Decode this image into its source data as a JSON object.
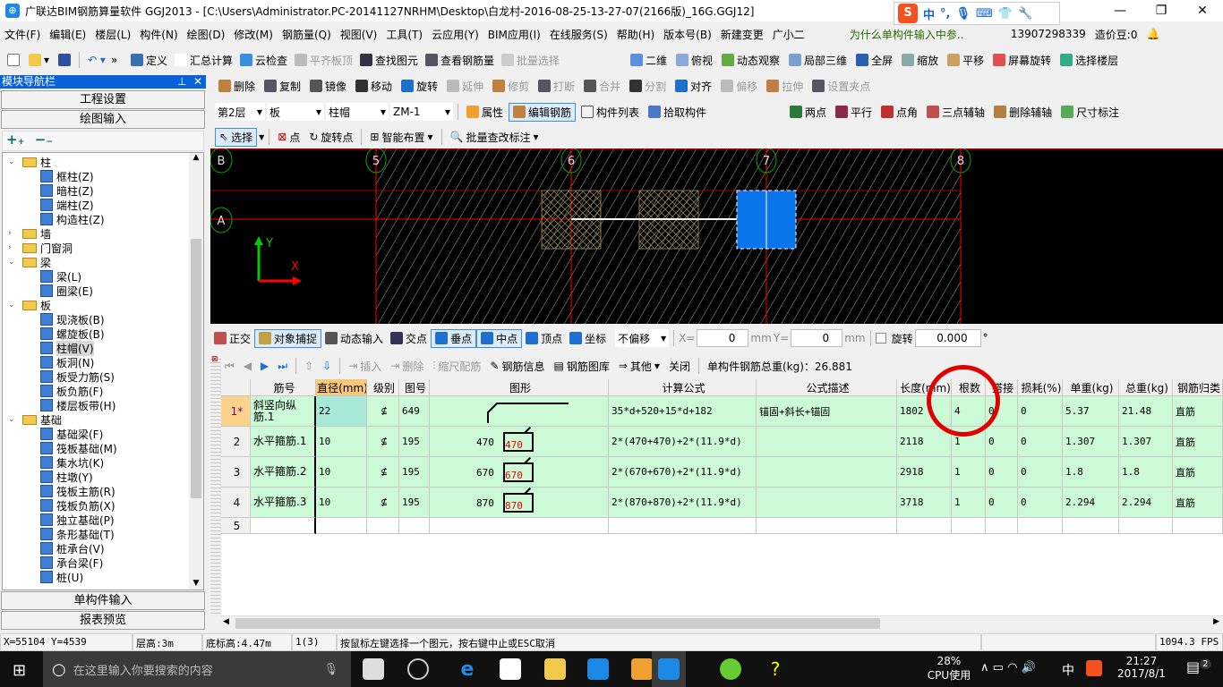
{
  "title": "广联达BIM钢筋算量软件 GGJ2013 - [C:\\Users\\Administrator.PC-20141127NRHM\\Desktop\\白龙村-2016-08-25-13-27-07(2166版)_16G.GGJ12]",
  "ime": {
    "lang": "中",
    "punct": "°,"
  },
  "menu": [
    "文件(F)",
    "编辑(E)",
    "楼层(L)",
    "构件(N)",
    "绘图(D)",
    "修改(M)",
    "钢筋量(Q)",
    "视图(V)",
    "工具(T)",
    "云应用(Y)",
    "BIM应用(I)",
    "在线服务(S)",
    "帮助(H)",
    "版本号(B)"
  ],
  "menu_extra": {
    "new_change": "新建变更",
    "assistant": "广小二",
    "tip": "为什么单构件输入中参..",
    "account": "13907298339",
    "beans": "造价豆:0"
  },
  "toolbar1": [
    "定义",
    "汇总计算",
    "云检查",
    "平齐板顶",
    "查找图元",
    "查看钢筋量",
    "批量选择"
  ],
  "toolbar1_right": [
    "二维",
    "俯视",
    "动态观察",
    "局部三维",
    "全屏",
    "缩放",
    "平移",
    "屏幕旋转",
    "选择楼层"
  ],
  "toolbar2": [
    "删除",
    "复制",
    "镜像",
    "移动",
    "旋转",
    "延伸",
    "修剪",
    "打断",
    "合并",
    "分割",
    "对齐",
    "偏移",
    "拉伸",
    "设置夹点"
  ],
  "toolbar3": {
    "floor": "第2层",
    "type": "板",
    "subtype": "柱帽",
    "component": "ZM-1",
    "buttons": [
      "属性",
      "编辑钢筋",
      "构件列表",
      "拾取构件"
    ],
    "axis_buttons": [
      "两点",
      "平行",
      "点角",
      "三点辅轴",
      "删除辅轴",
      "尺寸标注"
    ]
  },
  "toolbar4": [
    "选择",
    "点",
    "旋转点",
    "智能布置",
    "批量查改标注"
  ],
  "nav": {
    "title": "模块导航栏",
    "project_settings": "工程设置",
    "drawing_input": "绘图输入",
    "single_input": "单构件输入",
    "report_preview": "报表预览",
    "tree": [
      {
        "label": "柱",
        "level": 0,
        "folder": true,
        "open": true
      },
      {
        "label": "框柱(Z)",
        "level": 1
      },
      {
        "label": "暗柱(Z)",
        "level": 1
      },
      {
        "label": "端柱(Z)",
        "level": 1
      },
      {
        "label": "构造柱(Z)",
        "level": 1
      },
      {
        "label": "墙",
        "level": 0,
        "folder": true,
        "open": false
      },
      {
        "label": "门窗洞",
        "level": 0,
        "folder": true,
        "open": false
      },
      {
        "label": "梁",
        "level": 0,
        "folder": true,
        "open": true
      },
      {
        "label": "梁(L)",
        "level": 1
      },
      {
        "label": "圈梁(E)",
        "level": 1
      },
      {
        "label": "板",
        "level": 0,
        "folder": true,
        "open": true
      },
      {
        "label": "现浇板(B)",
        "level": 1
      },
      {
        "label": "螺旋板(B)",
        "level": 1
      },
      {
        "label": "柱帽(V)",
        "level": 1,
        "selected": true
      },
      {
        "label": "板洞(N)",
        "level": 1
      },
      {
        "label": "板受力筋(S)",
        "level": 1
      },
      {
        "label": "板负筋(F)",
        "level": 1
      },
      {
        "label": "楼层板带(H)",
        "level": 1
      },
      {
        "label": "基础",
        "level": 0,
        "folder": true,
        "open": true
      },
      {
        "label": "基础梁(F)",
        "level": 1
      },
      {
        "label": "筏板基础(M)",
        "level": 1
      },
      {
        "label": "集水坑(K)",
        "level": 1
      },
      {
        "label": "柱墩(Y)",
        "level": 1
      },
      {
        "label": "筏板主筋(R)",
        "level": 1
      },
      {
        "label": "筏板负筋(X)",
        "level": 1
      },
      {
        "label": "独立基础(P)",
        "level": 1
      },
      {
        "label": "条形基础(T)",
        "level": 1
      },
      {
        "label": "桩承台(V)",
        "level": 1
      },
      {
        "label": "承台梁(F)",
        "level": 1
      },
      {
        "label": "桩(U)",
        "level": 1
      }
    ]
  },
  "canvas": {
    "axis_rows": [
      "B",
      "A"
    ],
    "axis_cols": [
      "5",
      "6",
      "7",
      "8"
    ],
    "x_label": "X",
    "y_label": "Y"
  },
  "snap": {
    "items": [
      "正交",
      "对象捕捉",
      "动态输入",
      "交点",
      "垂点",
      "中点",
      "顶点",
      "坐标"
    ],
    "offset": "不偏移",
    "x_label": "X=",
    "x": "0",
    "y_label": "Y=",
    "y": "0",
    "unit": "mm",
    "rotate_label": "旋转",
    "rotate": "0.000",
    "deg": "°"
  },
  "rebar_toolbar": {
    "items": [
      "插入",
      "删除",
      "缩尺配筋",
      "钢筋信息",
      "钢筋图库",
      "其他",
      "关闭"
    ],
    "total": "单构件钢筋总重(kg)：26.881"
  },
  "table": {
    "headers": [
      "筋号",
      "直径(mm)",
      "级别",
      "图号",
      "图形",
      "计算公式",
      "公式描述",
      "长度(mm)",
      "根数",
      "搭接",
      "损耗(%)",
      "单重(kg)",
      "总重(kg)",
      "钢筋归类"
    ],
    "rows": [
      {
        "idx": "1*",
        "name": "斜竖向纵筋.1",
        "dia": "22",
        "grade": "⊈",
        "fig": "649",
        "shape": {
          "a": "35",
          "b": "330",
          "c": "132",
          "d": "1339"
        },
        "formula": "35*d+520+15*d+182",
        "desc": "锚固+斜长+锚固",
        "len": "1802",
        "count": "4",
        "lap": "0",
        "loss": "0",
        "unit_w": "5.37",
        "total_w": "21.48",
        "cat": "直筋"
      },
      {
        "idx": "2",
        "name": "水平箍筋.1",
        "dia": "10",
        "grade": "⊈",
        "fig": "195",
        "shape": {
          "a": "470",
          "b": "470"
        },
        "formula": "2*(470+470)+2*(11.9*d)",
        "desc": "",
        "len": "2118",
        "count": "1",
        "lap": "0",
        "loss": "0",
        "unit_w": "1.307",
        "total_w": "1.307",
        "cat": "直筋"
      },
      {
        "idx": "3",
        "name": "水平箍筋.2",
        "dia": "10",
        "grade": "⊈",
        "fig": "195",
        "shape": {
          "a": "670",
          "b": "670"
        },
        "formula": "2*(670+670)+2*(11.9*d)",
        "desc": "",
        "len": "2918",
        "count": "1",
        "lap": "0",
        "loss": "0",
        "unit_w": "1.8",
        "total_w": "1.8",
        "cat": "直筋"
      },
      {
        "idx": "4",
        "name": "水平箍筋.3",
        "dia": "10",
        "grade": "⊈",
        "fig": "195",
        "shape": {
          "a": "870",
          "b": "870"
        },
        "formula": "2*(870+870)+2*(11.9*d)",
        "desc": "",
        "len": "3718",
        "count": "1",
        "lap": "0",
        "loss": "0",
        "unit_w": "2.294",
        "total_w": "2.294",
        "cat": "直筋"
      },
      {
        "idx": "5",
        "name": "",
        "dia": "",
        "grade": "",
        "fig": "",
        "shape": null,
        "formula": "",
        "desc": "",
        "len": "",
        "count": "",
        "lap": "",
        "loss": "",
        "unit_w": "",
        "total_w": "",
        "cat": ""
      }
    ]
  },
  "status": {
    "coords": "X=55104 Y=4539",
    "floor_height": "层高:3m",
    "bottom_elev": "底标高:4.47m",
    "selection": "1(3)",
    "hint": "按鼠标左键选择一个图元，按右键中止或ESC取消",
    "fps": "1094.3 FPS"
  },
  "taskbar": {
    "search_placeholder": "在这里输入你要搜索的内容",
    "cpu": "28%",
    "cpu_label": "CPU使用",
    "ime": "中",
    "time": "21:27",
    "date": "2017/8/1",
    "notifications": "2"
  },
  "colors": {
    "nav_header": "#0a62d8",
    "canvas_bg": "#000000",
    "row_green": "#ccfad6",
    "selected_block": "#0a74ea",
    "annotation": "#e00000"
  }
}
